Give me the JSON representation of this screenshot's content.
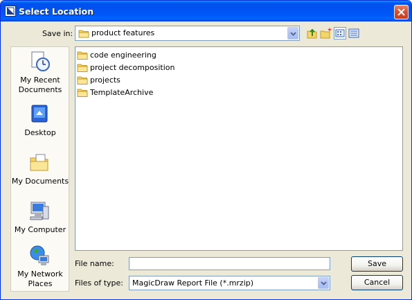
{
  "window": {
    "title": "Select Location"
  },
  "save_in": {
    "label": "Save in:",
    "value": "product features"
  },
  "places": [
    {
      "label": "My Recent\nDocuments",
      "icon": "recent-documents-icon"
    },
    {
      "label": "Desktop",
      "icon": "desktop-icon"
    },
    {
      "label": "My Documents",
      "icon": "my-documents-icon"
    },
    {
      "label": "My Computer",
      "icon": "my-computer-icon"
    },
    {
      "label": "My Network\nPlaces",
      "icon": "network-places-icon"
    }
  ],
  "files": [
    {
      "name": "code engineering"
    },
    {
      "name": "project decomposition"
    },
    {
      "name": "projects"
    },
    {
      "name": "TemplateArchive"
    }
  ],
  "file_name": {
    "label": "File name:",
    "value": ""
  },
  "file_type": {
    "label": "Files of type:",
    "value": "MagicDraw Report File (*.mrzip)"
  },
  "buttons": {
    "save": "Save",
    "cancel": "Cancel"
  },
  "colors": {
    "title_bar": "#0054e3",
    "dialog_bg": "#ece9d8",
    "folder": "#f4d56b",
    "close": "#d7502f"
  }
}
